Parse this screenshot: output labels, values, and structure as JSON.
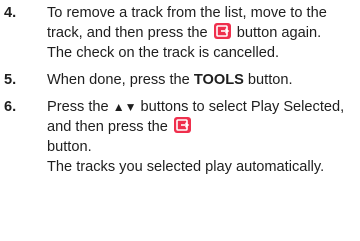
{
  "steps": [
    {
      "number": "4.",
      "line1": "To remove a track from the list, move to the track, and then press the",
      "icon": "enter-button-icon",
      "line1_end": "button again.",
      "note": "The check on the track is cancelled."
    },
    {
      "number": "5.",
      "text_before": "When done, press the",
      "button_name": "TOOLS",
      "text_after": "button."
    },
    {
      "number": "6.",
      "text_before": "Press the",
      "arrows": "▲▼",
      "text_mid": "buttons to select Play Selected, and then press the",
      "icon": "enter-button-icon",
      "text_after": "button.",
      "note": "The tracks you selected play automatically."
    }
  ],
  "colors": {
    "icon_bg": "#ef2f4d",
    "text": "#1e1e1e"
  }
}
